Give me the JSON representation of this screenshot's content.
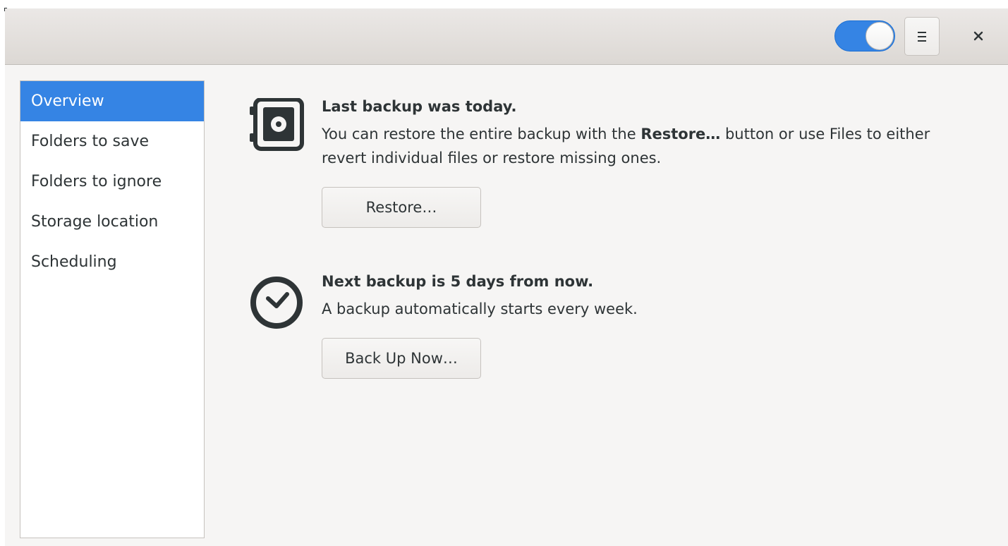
{
  "header": {
    "toggle_state": "on",
    "toggle_color": "#3584e4",
    "menu_icon": "hamburger-menu-icon",
    "close_icon": "close-icon"
  },
  "sidebar": {
    "items": [
      {
        "label": "Overview",
        "selected": true
      },
      {
        "label": "Folders to save",
        "selected": false
      },
      {
        "label": "Folders to ignore",
        "selected": false
      },
      {
        "label": "Storage location",
        "selected": false
      },
      {
        "label": "Scheduling",
        "selected": false
      }
    ]
  },
  "overview": {
    "last_backup": {
      "icon": "safe-icon",
      "title": "Last backup was today.",
      "text_before": "You can restore the entire backup with the ",
      "text_bold": "Restore…",
      "text_after": " button or use Files to either revert individual files or restore missing ones.",
      "button_label": "Restore…"
    },
    "next_backup": {
      "icon": "clock-icon",
      "title": "Next backup is 5 days from now.",
      "text": "A backup automatically starts every week.",
      "button_label": "Back Up Now…"
    }
  }
}
